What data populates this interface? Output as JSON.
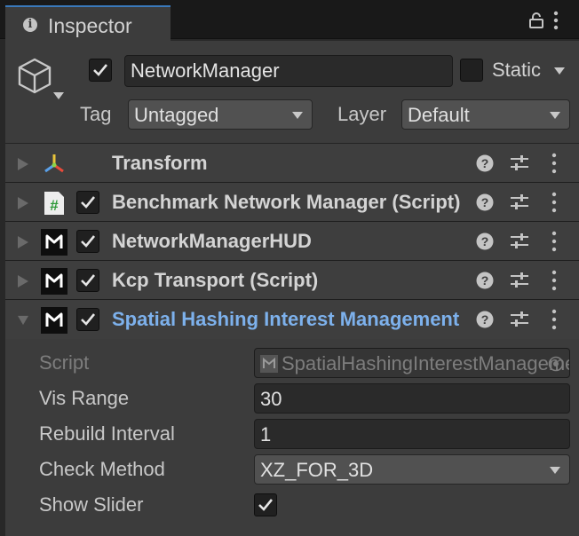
{
  "window": {
    "tab_title": "Inspector",
    "icons": [
      "info-icon",
      "lock-icon",
      "kebab-menu-icon"
    ]
  },
  "header": {
    "active": true,
    "name": "NetworkManager",
    "static_label": "Static",
    "static_checked": false,
    "tag_label": "Tag",
    "tag_value": "Untagged",
    "layer_label": "Layer",
    "layer_value": "Default"
  },
  "components": [
    {
      "title": "Transform",
      "icon": "transform-axes-icon",
      "expanded": false,
      "has_checkbox": false
    },
    {
      "title": "Benchmark Network Manager (Script)",
      "icon": "csharp-script-icon",
      "expanded": false,
      "has_checkbox": true,
      "checked": true
    },
    {
      "title": "NetworkManagerHUD",
      "icon": "mirror-logo-icon",
      "expanded": false,
      "has_checkbox": true,
      "checked": true
    },
    {
      "title": "Kcp Transport (Script)",
      "icon": "mirror-logo-icon",
      "expanded": false,
      "has_checkbox": true,
      "checked": true
    },
    {
      "title": "Spatial Hashing Interest Management",
      "icon": "mirror-logo-icon",
      "expanded": true,
      "has_checkbox": true,
      "checked": true
    }
  ],
  "properties": {
    "script_label": "Script",
    "script_value": "SpatialHashingInterestManagement",
    "vis_range_label": "Vis Range",
    "vis_range_value": "30",
    "rebuild_label": "Rebuild Interval",
    "rebuild_value": "1",
    "check_method_label": "Check Method",
    "check_method_value": "XZ_FOR_3D",
    "show_slider_label": "Show Slider",
    "show_slider_checked": true
  },
  "colors": {
    "accent_blue": "#3a79bb",
    "active_title": "#7db1ec",
    "panel_bg": "#3c3c3c"
  }
}
